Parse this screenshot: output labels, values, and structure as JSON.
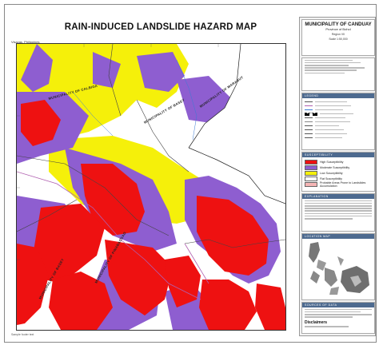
{
  "map": {
    "title": "RAIN-INDUCED LANDSLIDE HAZARD MAP",
    "location_label": "Visayas, Philippines",
    "footer_note": "Sample footer text",
    "municipality_labels": [
      "MUNICIPALITY OF CALBIGA",
      "MUNICIPALITY OF BASEY",
      "MUNICIPALITY OF MARABUT",
      "MUNICIPALITY OF PINABACDAO",
      "MUNICIPALITY OF BASEY"
    ]
  },
  "panel": {
    "municipality_title": "MUNICIPALITY OF CANDUAY",
    "province": "Province of Bohol",
    "region": "Region VII",
    "scale_label": "Scale 1:50,000",
    "legend_header": "LEGEND",
    "hazard_header": "SUSCEPTIBILITY",
    "hazard_classes": [
      {
        "label": "High Susceptibility",
        "color": "#ee1111"
      },
      {
        "label": "Moderate Susceptibility",
        "color": "#8e5ed0"
      },
      {
        "label": "Low Susceptibility",
        "color": "#f5f00a"
      },
      {
        "label": "Flat Susceptibility",
        "color": "#ffffff"
      },
      {
        "label": "Probable Areas Prone to Landslides Accumulation",
        "color": "#f5b5b5"
      }
    ],
    "explanation_header": "EXPLANATION",
    "location_header": "LOCATION MAP",
    "sources_header": "SOURCES OF DATA",
    "disclaimer_header": "Disclaimers"
  },
  "colors": {
    "high": "#ee1111",
    "moderate": "#8e5ed0",
    "low": "#f5f00a",
    "panel_header": "#4d6a8f"
  }
}
